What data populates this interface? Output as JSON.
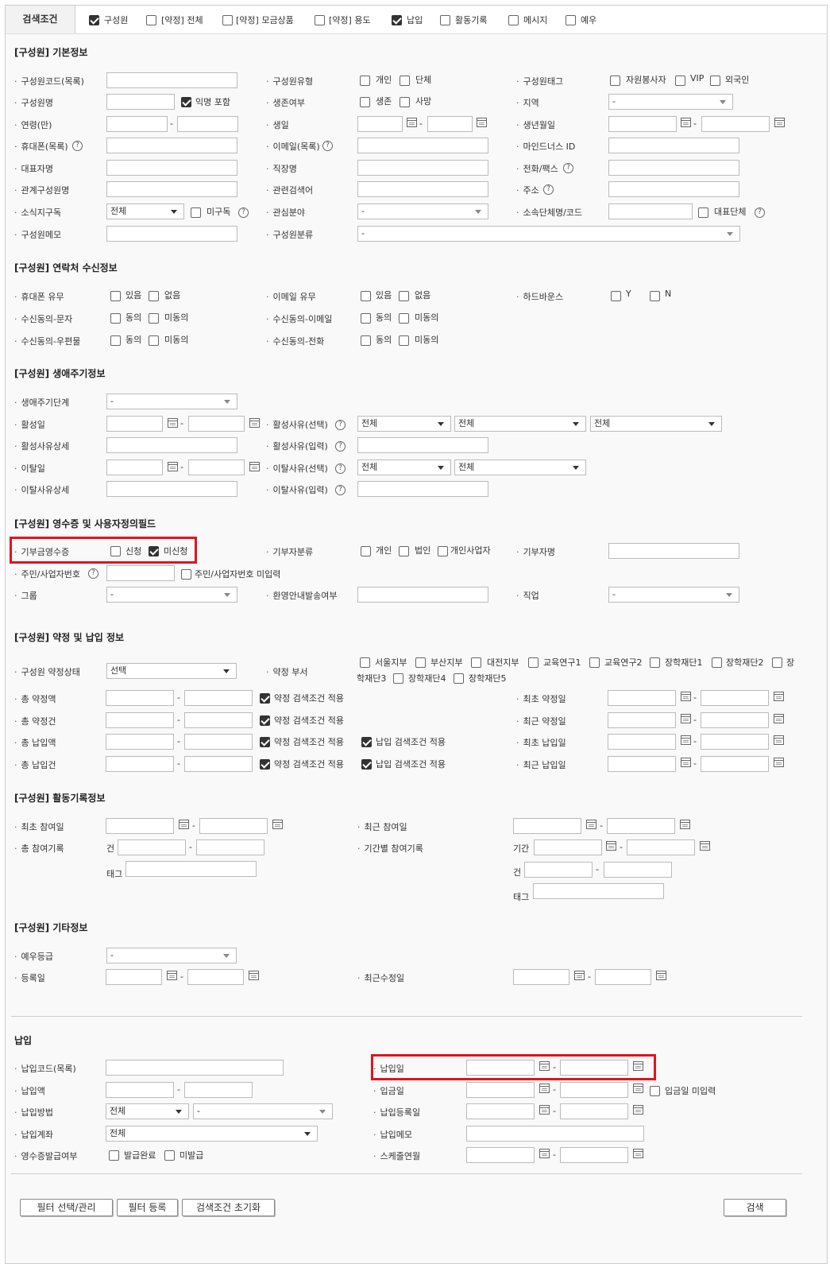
{
  "tabs": {
    "head": "검색조건",
    "items": [
      {
        "label": "구성원",
        "checked": true
      },
      {
        "label": "[약정] 전체",
        "checked": false
      },
      {
        "label": "[약정] 모금상품",
        "checked": false
      },
      {
        "label": "[약정] 용도",
        "checked": false
      },
      {
        "label": "납입",
        "checked": true
      },
      {
        "label": "활동기록",
        "checked": false
      },
      {
        "label": "메시지",
        "checked": false
      },
      {
        "label": "예우",
        "checked": false
      }
    ]
  },
  "sections": {
    "basic": "[구성원] 기본정보",
    "contact": "[구성원] 연락처 수신정보",
    "life": "[구성원] 생애주기정보",
    "receipt": "[구성원] 영수증 및 사용자정의필드",
    "pledge": "[구성원] 약정 및 납입 정보",
    "activity": "[구성원] 활동기록정보",
    "etc": "[구성원] 기타정보",
    "payment": "납입"
  },
  "basic": {
    "code": "구성원코드(목록)",
    "type": "구성원유형",
    "type_opts": [
      "개인",
      "단체"
    ],
    "tag": "구성원태그",
    "tag_opts": [
      "자원봉사자",
      "VIP",
      "외국인"
    ],
    "name": "구성원명",
    "anon": "익명 포함",
    "alive": "생존여부",
    "alive_opts": [
      "생존",
      "사망"
    ],
    "region": "지역",
    "region_val": "-",
    "age": "연령(만)",
    "birthday": "생일",
    "birthdate": "생년월일",
    "mobile": "휴대폰(목록)",
    "email": "이메일(목록)",
    "mindnx": "마인드너스 ID",
    "rep": "대표자명",
    "work": "직장명",
    "phone": "전화/팩스",
    "related_name": "관계구성원명",
    "related_search": "관련검색어",
    "address": "주소",
    "news": "소식지구독",
    "news_val": "전체",
    "unsub": "미구독",
    "interest": "관심분야",
    "interest_val": "-",
    "org": "소속단체명/코드",
    "org_rep": "대표단체",
    "memo": "구성원메모",
    "category": "구성원분류",
    "category_val": "-"
  },
  "contact": {
    "mobile": "휴대폰 유무",
    "yes": "있음",
    "no": "없음",
    "email": "이메일 유무",
    "bounce": "하드바운스",
    "y": "Y",
    "n": "N",
    "sms": "수신동의-문자",
    "agree": "동의",
    "disagree": "미동의",
    "email_agree": "수신동의-이메일",
    "post": "수신동의-우편물",
    "tel": "수신동의-전화"
  },
  "life": {
    "stage": "생애주기단계",
    "stage_val": "-",
    "active_date": "활성일",
    "active_reason": "활성사유(선택)",
    "all": "전체",
    "active_detail": "활성사유상세",
    "active_input": "활성사유(입력)",
    "leave_date": "이탈일",
    "leave_reason": "이탈사유(선택)",
    "leave_detail": "이탈사유상세",
    "leave_input": "이탈사유(입력)"
  },
  "receipt": {
    "donation_receipt": "기부금영수증",
    "apply": "신청",
    "not_apply": "미신청",
    "donor_class": "기부자분류",
    "dc_opts": [
      "개인",
      "법인",
      "개인사업자"
    ],
    "donor_name": "기부자명",
    "reg_no": "주민/사업자번호",
    "reg_missing": "주민/사업자번호 미입력",
    "group": "그룹",
    "group_val": "-",
    "welcome": "환영안내발송여부",
    "job": "직업",
    "job_val": "-"
  },
  "pledge": {
    "status": "구성원 약정상태",
    "status_val": "선택",
    "dept": "약정 부서",
    "depts": [
      "서울지부",
      "부산지부",
      "대전지부",
      "교육연구1",
      "교육연구2",
      "장학재단1",
      "장학재단2",
      "장",
      "학재단3",
      "장학재단4",
      "장학재단5"
    ],
    "total_amt": "총 약정액",
    "total_cnt": "총 약정건",
    "pay_amt": "총 납입액",
    "pay_cnt": "총 납입건",
    "apply_pledge": "약정 검색조건 적용",
    "apply_pay": "납입 검색조건 적용",
    "first_pledge": "최초 약정일",
    "last_pledge": "최근 약정일",
    "first_pay": "최초 납입일",
    "last_pay": "최근 납입일"
  },
  "activity": {
    "first": "최초 참여일",
    "last": "최근 참여일",
    "total": "총 참여기록",
    "period": "기간별 참여기록",
    "count": "건",
    "tag": "태그",
    "range": "기간"
  },
  "etc": {
    "grade": "예우등급",
    "grade_val": "-",
    "reg": "등록일",
    "modified": "최근수정일"
  },
  "payment": {
    "code": "납입코드(목록)",
    "date": "납입일",
    "amount": "납입액",
    "deposit": "입금일",
    "deposit_missing": "입금일 미입력",
    "method": "납입방법",
    "method_val": "전체",
    "method_sub": "-",
    "reg_date": "납입등록일",
    "account": "납입계좌",
    "account_val": "전체",
    "memo": "납입메모",
    "receipt": "영수증발급여부",
    "issued": "발급완료",
    "not_issued": "미발급",
    "schedule": "스케줄연월"
  },
  "buttons": {
    "filter_manage": "필터 선택/관리",
    "filter_reg": "필터 등록",
    "reset": "검색조건 초기화",
    "search": "검색"
  }
}
